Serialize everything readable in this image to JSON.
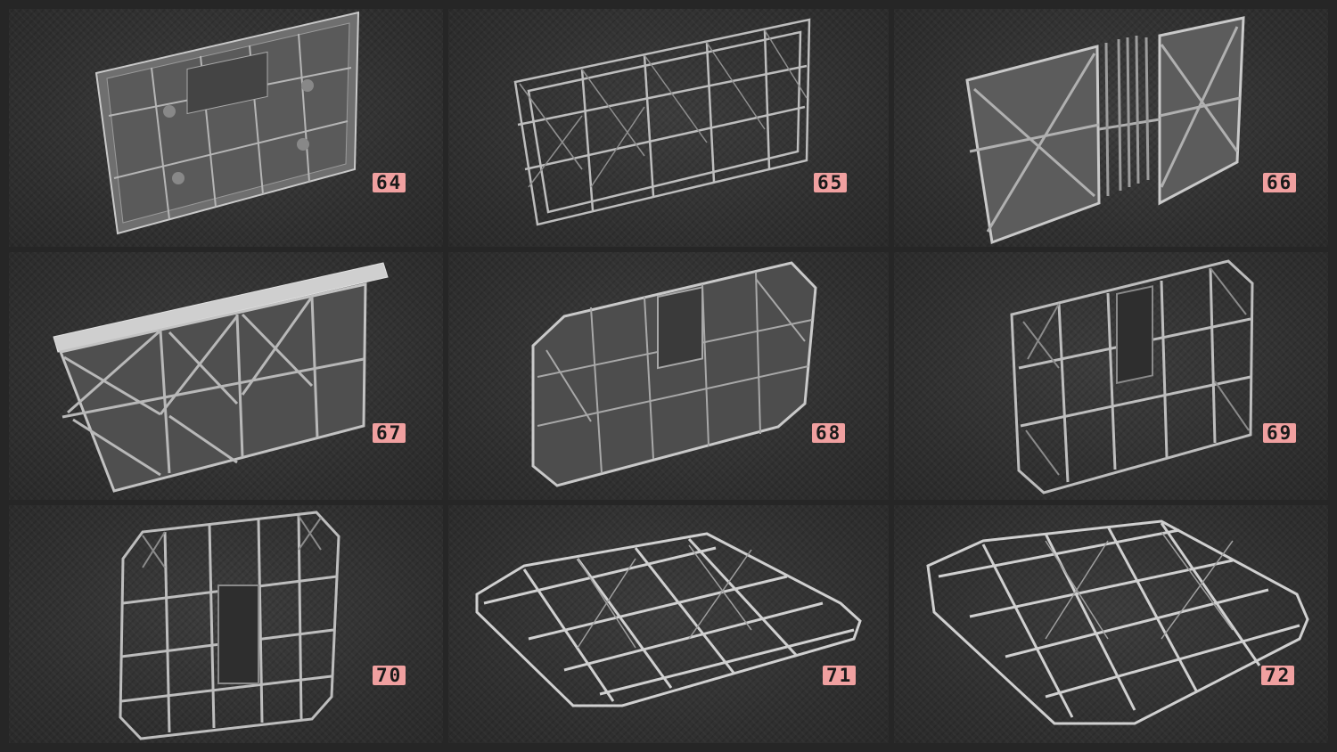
{
  "tiles": [
    {
      "label": "64",
      "colors": {
        "badge": "#f0a0a0"
      }
    },
    {
      "label": "65"
    },
    {
      "label": "66"
    },
    {
      "label": "67"
    },
    {
      "label": "68"
    },
    {
      "label": "69"
    },
    {
      "label": "70"
    },
    {
      "label": "71"
    },
    {
      "label": "72"
    }
  ],
  "colors": {
    "background": "#262626",
    "tile": "#333333",
    "metal": "#b8b8b8",
    "badge": "#f0a0a0"
  }
}
